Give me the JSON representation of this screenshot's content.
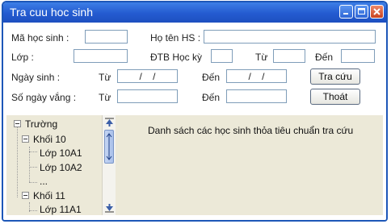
{
  "window": {
    "title": "Tra cuu hoc sinh",
    "controls": [
      "minimize-icon",
      "maximize-icon",
      "close-icon"
    ]
  },
  "form": {
    "student_id_label": "Mã học sinh :",
    "student_id_value": "",
    "full_name_label": "Họ tên HS :",
    "full_name_value": "",
    "class_label": "Lớp :",
    "class_value": "",
    "gpa_label": "ĐTB Học kỳ",
    "gpa_value": "",
    "from_label": "Từ",
    "to_label": "Đến",
    "gpa_from_value": "",
    "gpa_to_value": "",
    "birthdate_label": "Ngày sinh :",
    "birth_from_value": "/ /",
    "birth_to_value": "/ /",
    "absences_label": "Số ngày vắng :",
    "absences_from_value": "",
    "absences_to_value": ""
  },
  "buttons": {
    "search": "Tra cứu",
    "exit": "Thoát"
  },
  "tree": {
    "root": "Trường",
    "grade_10": "Khối 10",
    "class_10a1": "Lớp 10A1",
    "class_10a2": "Lớp 10A2",
    "ellipsis": "...",
    "grade_11": "Khối 11",
    "class_11a1": "Lớp 11A1"
  },
  "results": {
    "caption": "Danh sách các học sinh thỏa tiêu chuẩn tra cứu"
  },
  "colors": {
    "titlebar": "#245bd0",
    "panel_bg": "#ece9d8",
    "input_border": "#7f9db9"
  }
}
